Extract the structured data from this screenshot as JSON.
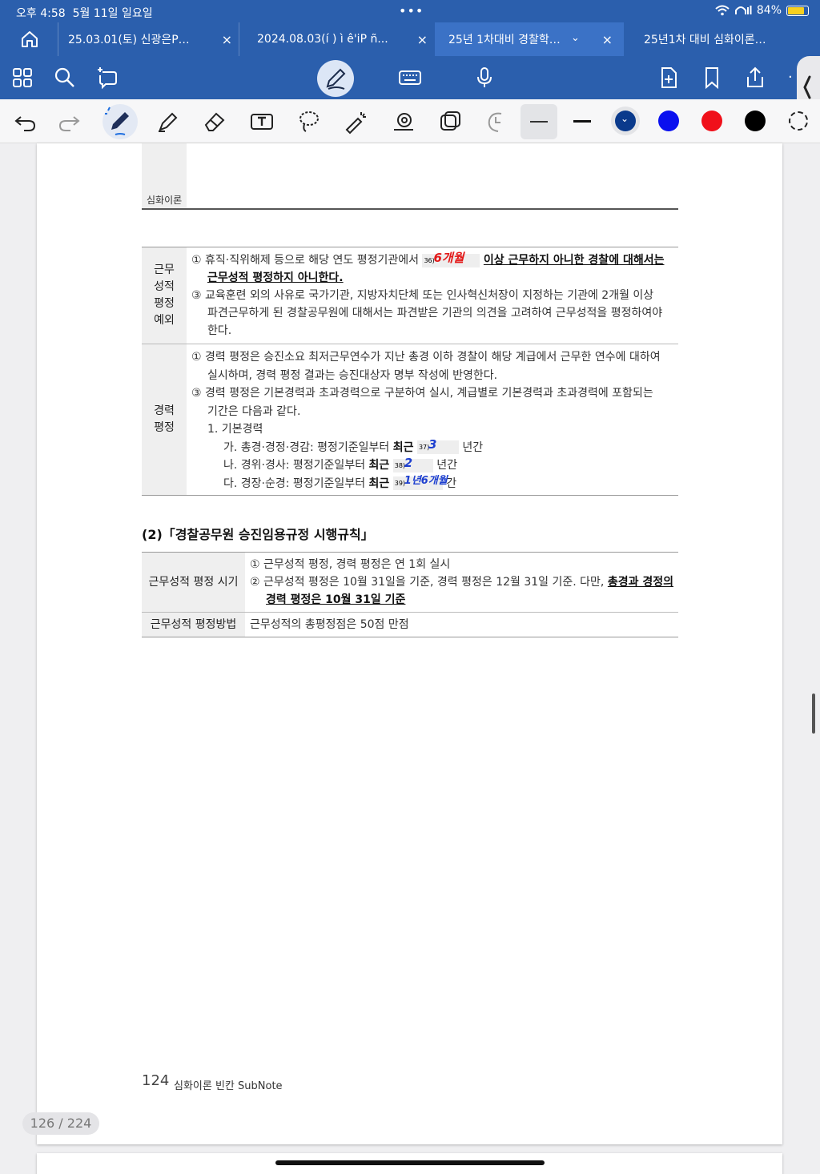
{
  "status": {
    "time": "오후 4:58",
    "date": "5월 11일 일요일",
    "battery": "84%",
    "battery_level": 0.84
  },
  "tabs": [
    {
      "label": "25.03.01(토) 신광은P…"
    },
    {
      "label": "2024.08.03(í ) ì ê'iP ñ..."
    },
    {
      "label": "25년 1차대비 경찰학…"
    },
    {
      "label": "25년1차 대비 심화이론…"
    }
  ],
  "colors": {
    "chrome_blue": "#2b5fad",
    "swatch_navy": "#0a3a8c",
    "swatch_blue": "#0a10ef",
    "swatch_red": "#f0101a",
    "swatch_black": "#000000"
  },
  "doc": {
    "header_label": "심화이론",
    "table1": {
      "rows": [
        {
          "head": [
            "근무",
            "성적",
            "평정",
            "예외"
          ],
          "lines": {
            "l1_a": "① 휴직·직위해제 등으로 해당 연도 평정기관에서",
            "l1_blank_no": "36)",
            "l1_hw": "6개월",
            "l1_b": "이상 근무하지 아니한 경찰에 대해서는",
            "l2": "근무성적 평정하지 아니한다.",
            "l3": "③ 교육훈련 외의 사유로 국가기관, 지방자치단체 또는 인사혁신처장이 지정하는 기관에 2개월 이상",
            "l4": "파견근무하게 된 경찰공무원에 대해서는 파견받은 기관의 의견을 고려하여 근무성적을 평정하여야",
            "l5": "한다."
          }
        },
        {
          "head": [
            "경력",
            "평정"
          ],
          "lines": {
            "l1": "① 경력 평정은 승진소요 최저근무연수가 지난 총경 이하 경찰이 해당 계급에서 근무한 연수에 대하여",
            "l2": "실시하며, 경력 평정 결과는 승진대상자 명부 작성에 반영한다.",
            "l3": "③ 경력 평정은 기본경력과 초과경력으로 구분하여 실시, 계급별로 기본경력과 초과경력에 포함되는",
            "l4": "기간은 다음과 같다.",
            "l5": "1.  기본경력",
            "ga_a": "가.  총경·경정·경감: 평정기준일부터",
            "ga_bold": "최근",
            "ga_no": "37)",
            "ga_hw": "3",
            "ga_b": "년간",
            "na_a": "나.  경위·경사: 평정기준일부터",
            "na_bold": "최근",
            "na_no": "38)",
            "na_hw": "2",
            "na_b": "년간",
            "da_a": "다.  경장·순경: 평정기준일부터",
            "da_bold": "최근",
            "da_no": "39)",
            "da_hw": "1년6개월",
            "da_b": "간"
          }
        }
      ]
    },
    "section2_title": "(2)「경찰공무원 승진임용규정 시행규칙」",
    "table2": {
      "rows": [
        {
          "head": "근무성적 평정 시기",
          "l1": "① 근무성적 평정, 경력 평정은 연 1회 실시",
          "l2_a": "② 근무성적 평정은 10월 31일을 기준, 경력 평정은 12월 31일 기준. 다만,",
          "l2_ul": "총경과 경정의",
          "l3_ul": "경력 평정은 10월 31일 기준"
        },
        {
          "head": "근무성적 평정방법",
          "l1": "근무성적의 총평정점은 50점 만점"
        }
      ]
    },
    "footer_num": "124",
    "footer_text": "심화이론 빈칸 SubNote"
  },
  "page_indicator": "126 / 224"
}
